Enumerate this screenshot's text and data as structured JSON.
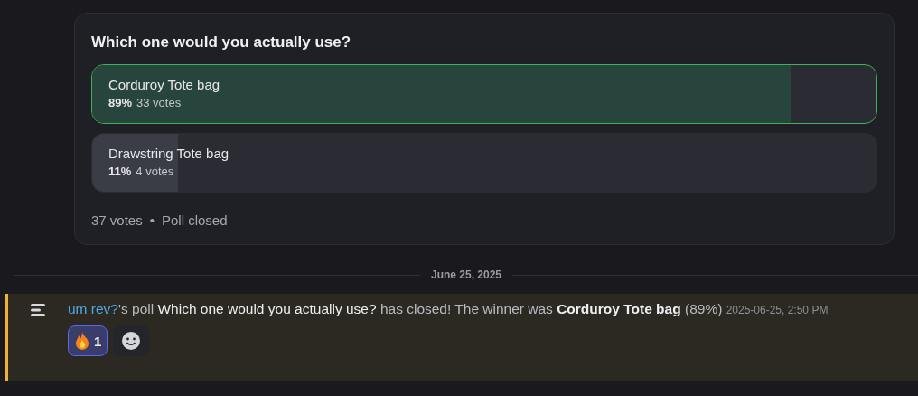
{
  "poll": {
    "question": "Which one would you actually use?",
    "options": [
      {
        "label": "Corduroy Tote bag",
        "percent": "89%",
        "votes": "33 votes",
        "level": 0.89,
        "selected": true
      },
      {
        "label": "Drawstring Tote bag",
        "percent": "11%",
        "votes": "4 votes",
        "level": 0.11,
        "selected": false
      }
    ],
    "total": "37 votes",
    "separator": "•",
    "status": "Poll closed"
  },
  "date_divider": "June 25, 2025",
  "message": {
    "parts": [
      {
        "kind": "link",
        "text": "um rev?"
      },
      {
        "kind": "plain",
        "text": "'s poll "
      },
      {
        "kind": "emphasis",
        "text": "Which one would you actually use?"
      },
      {
        "kind": "plain",
        "text": " has closed! The winner was "
      },
      {
        "kind": "strong",
        "text": "Corduroy Tote bag"
      },
      {
        "kind": "plain",
        "text": " (89%)"
      }
    ],
    "timestamp": "2025-06-25, 2:50 PM",
    "reactions": [
      {
        "count": "1",
        "selected": true
      }
    ]
  }
}
